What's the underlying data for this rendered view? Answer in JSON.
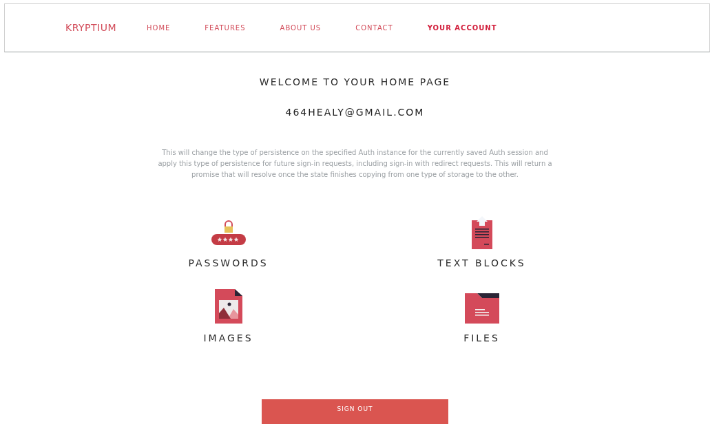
{
  "nav": {
    "brand": "KRYPTIUM",
    "links": [
      {
        "label": "HOME",
        "selected": false
      },
      {
        "label": "FEATURES",
        "selected": false
      },
      {
        "label": "ABOUT US",
        "selected": false
      },
      {
        "label": "CONTACT",
        "selected": false
      },
      {
        "label": "YOUR ACCOUNT",
        "selected": true
      }
    ]
  },
  "heading": "WELCOME TO YOUR HOME PAGE",
  "email": "464HEALY@GMAIL.COM",
  "description": "This will change the type of persistence on the specified Auth instance for the currently saved Auth session and apply this type of persistence for future sign-in requests, including sign-in with redirect requests. This will return a promise that will resolve once the state finishes copying from one type of storage to the other.",
  "tiles": [
    {
      "kind": "passwords",
      "label": "PASSWORDS"
    },
    {
      "kind": "text",
      "label": "TEXT BLOCKS"
    },
    {
      "kind": "images",
      "label": "IMAGES"
    },
    {
      "kind": "files",
      "label": "FILES"
    }
  ],
  "sign_out": "SIGN OUT"
}
